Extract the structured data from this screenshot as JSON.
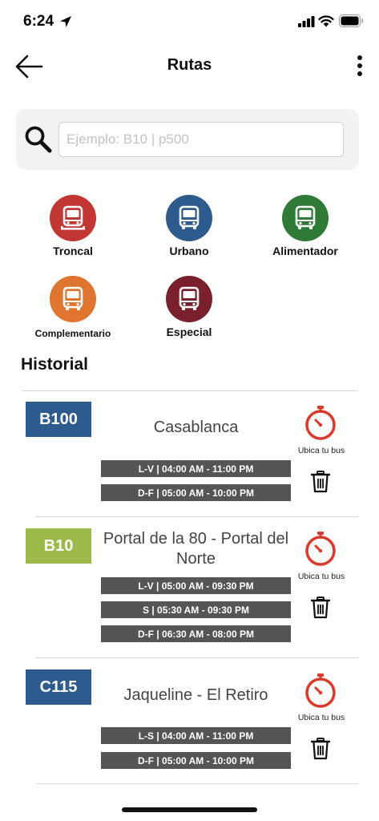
{
  "status_bar": {
    "time": "6:24"
  },
  "header": {
    "title": "Rutas"
  },
  "search": {
    "placeholder": "Ejemplo: B10 | p500"
  },
  "categories": [
    {
      "label": "Troncal",
      "color": "#c23633"
    },
    {
      "label": "Urbano",
      "color": "#2e5b8e"
    },
    {
      "label": "Alimentador",
      "color": "#2f7a36"
    },
    {
      "label": "Complementario",
      "color": "#e0752f"
    },
    {
      "label": "Especial",
      "color": "#7a1f2c"
    }
  ],
  "history": {
    "title": "Historial",
    "routes": [
      {
        "code": "B100",
        "badge_color": "#2e5b8e",
        "name": "Casablanca",
        "schedules": [
          "L-V | 04:00 AM - 11:00 PM",
          "D-F | 05:00 AM - 10:00 PM"
        ],
        "locate_label": "Ubica tu bus"
      },
      {
        "code": "B10",
        "badge_color": "#9cba49",
        "name": "Portal de la 80 - Portal del Norte",
        "schedules": [
          "L-V | 05:00 AM - 09:30 PM",
          "S | 05:30 AM - 09:30 PM",
          "D-F | 06:30 AM - 08:00 PM"
        ],
        "locate_label": "Ubica tu bus"
      },
      {
        "code": "C115",
        "badge_color": "#2e5b8e",
        "name": "Jaqueline - El Retiro",
        "schedules": [
          "L-S | 04:00 AM - 11:00 PM",
          "D-F | 05:00 AM - 10:00 PM"
        ],
        "locate_label": "Ubica tu bus"
      }
    ]
  },
  "icons": {
    "back": "arrow-left-icon",
    "more": "more-vertical-icon",
    "search": "search-icon",
    "bus": "bus-icon",
    "timer": "stopwatch-icon",
    "trash": "trash-icon"
  },
  "accent_timer_color": "#d93a2b"
}
